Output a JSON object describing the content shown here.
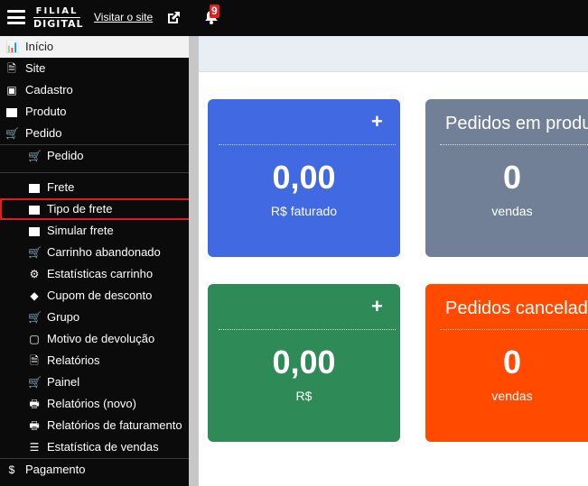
{
  "topbar": {
    "logo_line1": "FILIAL",
    "logo_line2": "DIGITAL",
    "visit_site": "Visitar o site",
    "notifications_count": "9"
  },
  "sidebar": {
    "top_items": [
      {
        "label": "Início",
        "icon": "chart-icon"
      },
      {
        "label": "Site",
        "icon": "file-icon"
      },
      {
        "label": "Cadastro",
        "icon": "briefcase-icon"
      },
      {
        "label": "Produto",
        "icon": "archive-icon"
      },
      {
        "label": "Pedido",
        "icon": "cart-icon"
      }
    ],
    "sub_items": [
      {
        "label": "Pedido",
        "icon": "cart-icon"
      },
      {
        "label": "Frete",
        "icon": "archive-icon"
      },
      {
        "label": "Tipo de frete",
        "icon": "archive-icon",
        "highlighted": true
      },
      {
        "label": "Simular frete",
        "icon": "archive-icon"
      },
      {
        "label": "Carrinho abandonado",
        "icon": "cart-icon"
      },
      {
        "label": "Estatísticas carrinho",
        "icon": "gears-icon"
      },
      {
        "label": "Cupom de desconto",
        "icon": "tag-icon"
      },
      {
        "label": "Grupo",
        "icon": "cart-icon"
      },
      {
        "label": "Motivo de devolução",
        "icon": "note-icon"
      },
      {
        "label": "Relatórios",
        "icon": "pdf-icon"
      },
      {
        "label": "Painel",
        "icon": "cart-icon"
      },
      {
        "label": "Relatórios (novo)",
        "icon": "print-icon"
      },
      {
        "label": "Relatórios de faturamento",
        "icon": "print-icon"
      },
      {
        "label": "Estatística de vendas",
        "icon": "list-icon"
      }
    ],
    "bottom_item": {
      "label": "Pagamento",
      "icon": "dollar-icon"
    }
  },
  "cards": [
    {
      "title": "",
      "value": "0,00",
      "sub": "R$ faturado",
      "has_plus": true,
      "color": "#4169e1"
    },
    {
      "title": "Pedidos em produ",
      "value": "0",
      "sub": "vendas",
      "has_plus": false,
      "color": "#718096"
    },
    {
      "title": "",
      "value": "0,00",
      "sub": "R$",
      "has_plus": true,
      "color": "#2e8b57"
    },
    {
      "title": "Pedidos cancelad",
      "value": "0",
      "sub": "vendas",
      "has_plus": false,
      "color": "#ff4a00"
    }
  ],
  "plus_symbol": "+"
}
